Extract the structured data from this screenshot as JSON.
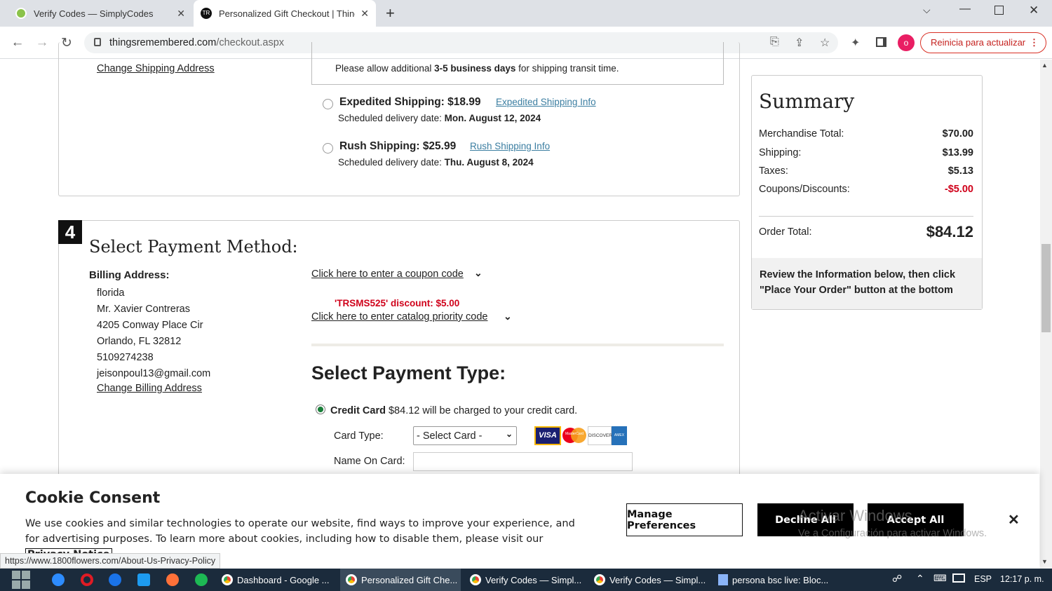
{
  "browser": {
    "tabs": [
      {
        "title": "Verify Codes — SimplyCodes",
        "close": "✕"
      },
      {
        "title": "Personalized Gift Checkout | Things Remembered",
        "close": "✕"
      }
    ],
    "new_tab": "+",
    "url_domain": "thingsremembered.com",
    "url_path": "/checkout.aspx",
    "profile_initial": "o",
    "update_button": "Reinicia para actualizar"
  },
  "shipping": {
    "change_address": "Change Shipping Address",
    "note_prefix": "Please allow additional ",
    "note_bold": "3-5 business days",
    "note_suffix": " for shipping transit time.",
    "options": [
      {
        "label": "Expedited Shipping: $18.99",
        "info": "Expedited Shipping Info",
        "date_prefix": "Scheduled delivery date: ",
        "date": "Mon. August 12, 2024"
      },
      {
        "label": "Rush Shipping: $25.99",
        "info": "Rush Shipping Info",
        "date_prefix": "Scheduled delivery date: ",
        "date": "Thu. August 8, 2024"
      }
    ]
  },
  "payment": {
    "step": "4",
    "title": "Select Payment Method:",
    "billing_label": "Billing Address:",
    "billing_lines": [
      "florida",
      "Mr. Xavier Contreras",
      "4205 Conway Place Cir",
      "Orlando, FL 32812",
      "5109274238",
      "jeisonpoul13@gmail.com"
    ],
    "change_billing": "Change Billing Address",
    "coupon_link": "Click here to enter a coupon code",
    "discount_msg": "'TRSMS525' discount: $5.00",
    "catalog_link": "Click here to enter catalog priority code",
    "type_title": "Select Payment Type:",
    "credit_label": "Credit Card",
    "credit_text": " $84.12 will be charged to your credit card.",
    "card_type_label": "Card Type:",
    "card_type_value": "- Select Card -",
    "cards": [
      "VISA",
      "MasterCard",
      "DISCOVER",
      "AMEX"
    ],
    "name_label": "Name On Card:",
    "name_value": ""
  },
  "summary": {
    "title": "Summary",
    "rows": [
      {
        "label": "Merchandise Total:",
        "value": "$70.00"
      },
      {
        "label": "Shipping:",
        "value": "$13.99"
      },
      {
        "label": "Taxes:",
        "value": "$5.13"
      },
      {
        "label": "Coupons/Discounts:",
        "value": "-$5.00"
      }
    ],
    "total_label": "Order Total:",
    "total_value": "$84.12",
    "review": "Review the Information below, then click \"Place Your Order\" button at the bottom",
    "discount_color": "#d0021b"
  },
  "cookie": {
    "title": "Cookie Consent",
    "text": "We use cookies and similar technologies to operate our website, find ways to improve your experience, and for advertising purposes. To learn more about cookies, including how to disable them, please visit our",
    "privacy": "Privacy Notice",
    "manage": "Manage Preferences",
    "decline": "Decline All",
    "accept": "Accept All",
    "close": "✕"
  },
  "watermark": {
    "line1": "Activar Windows",
    "line2": "Ve a Configuración para activar Windows."
  },
  "status_url": "https://www.1800flowers.com/About-Us-Privacy-Policy",
  "taskbar": {
    "items": [
      "Dashboard - Google ...",
      "Personalized Gift Che...",
      "Verify Codes — Simpl...",
      "Verify Codes — Simpl...",
      "persona bsc live: Bloc..."
    ],
    "lang": "ESP",
    "time": "12:17 p. m."
  }
}
